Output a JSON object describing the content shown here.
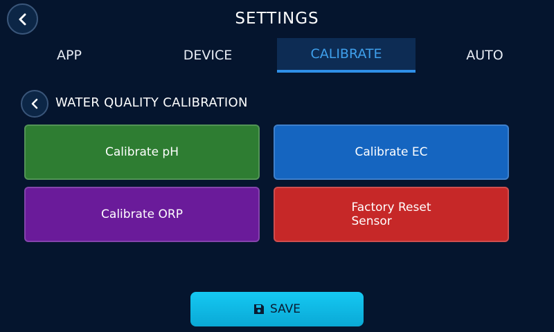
{
  "header": {
    "title": "SETTINGS",
    "back_icon": "chevron-left-icon"
  },
  "tabs": [
    {
      "label": "APP",
      "active": false
    },
    {
      "label": "DEVICE",
      "active": false
    },
    {
      "label": "CALIBRATE",
      "active": true
    },
    {
      "label": "AUTO",
      "active": false
    }
  ],
  "section": {
    "title": "WATER QUALITY CALIBRATION",
    "back_icon": "chevron-left-icon"
  },
  "buttons": [
    {
      "label": "Calibrate pH",
      "color": "#2e7d32"
    },
    {
      "label": "Calibrate EC",
      "color": "#1565c0"
    },
    {
      "label": "Calibrate ORP",
      "color": "#6a1b9a"
    },
    {
      "label": "Factory Reset\nSensor",
      "color": "#c62828"
    }
  ],
  "save": {
    "label": "SAVE",
    "icon": "floppy-disk-icon",
    "color": "#12bde8"
  },
  "colors": {
    "background": "#05152e",
    "tab_active_bg": "#0d2c54",
    "tab_active_text": "#3fa0ec"
  }
}
